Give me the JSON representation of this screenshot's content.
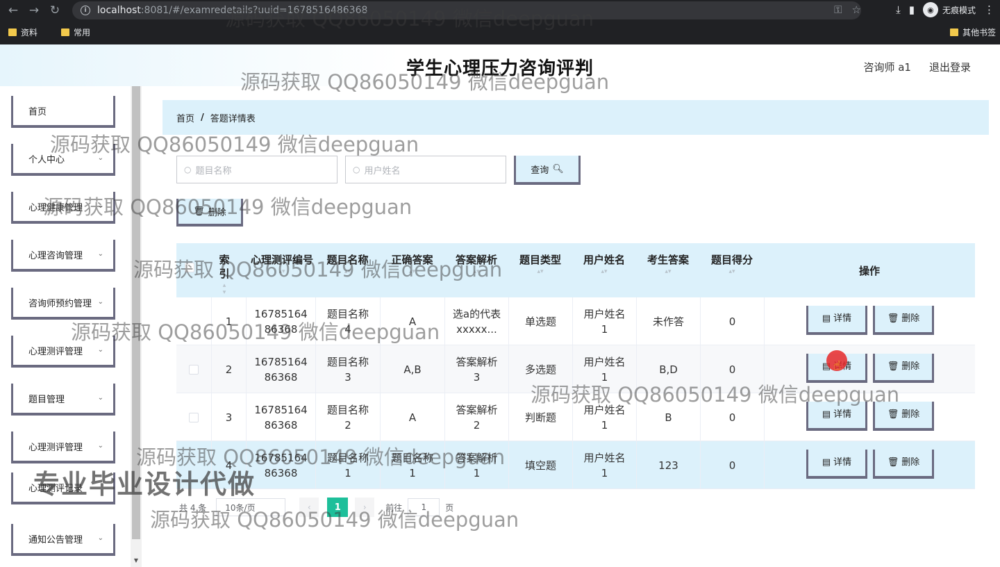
{
  "browser": {
    "url_main": "localhost",
    "url_rest": ":8081/#/examredetails?uuid=1678516486368",
    "incognito_label": "无痕模式",
    "bookmarks": [
      "资料",
      "常用"
    ],
    "bookmarks_right": "其他书签"
  },
  "header": {
    "title": "学生心理压力咨询评判",
    "user": "咨询师 a1",
    "logout": "退出登录"
  },
  "sidebar": {
    "items": [
      {
        "label": "首页",
        "chevron": false
      },
      {
        "label": "个人中心",
        "chevron": true
      },
      {
        "label": "心理健康管理",
        "chevron": true
      },
      {
        "label": "心理咨询管理",
        "chevron": true
      },
      {
        "label": "咨询师预约管理",
        "chevron": true
      },
      {
        "label": "心理测评管理",
        "chevron": true
      },
      {
        "label": "题目管理",
        "chevron": true
      },
      {
        "label": "心理测评管理",
        "chevron": true
      },
      {
        "label": "心理测评记录",
        "chevron": false
      },
      {
        "label": "通知公告管理",
        "chevron": true
      }
    ]
  },
  "breadcrumb": {
    "home": "首页",
    "sep": "/",
    "current": "答题详情表"
  },
  "search": {
    "question_placeholder": "题目名称",
    "user_placeholder": "用户姓名",
    "query_label": "查询",
    "delete_label": "删除"
  },
  "table": {
    "headers": [
      "索引",
      "心理测评编号",
      "题目名称",
      "正确答案",
      "答案解析",
      "题目类型",
      "用户姓名",
      "考生答案",
      "题目得分",
      "操作"
    ],
    "rows": [
      {
        "index": "1",
        "code": "1678516486368",
        "question": "题目名称4",
        "correct": "A",
        "analysis": "选a的代表xxxxx...",
        "type": "单选题",
        "user": "用户姓名1",
        "answer": "未作答",
        "score": "0"
      },
      {
        "index": "2",
        "code": "1678516486368",
        "question": "题目名称3",
        "correct": "A,B",
        "analysis": "答案解析3",
        "type": "多选题",
        "user": "用户姓名1",
        "answer": "B,D",
        "score": "0"
      },
      {
        "index": "3",
        "code": "1678516486368",
        "question": "题目名称2",
        "correct": "A",
        "analysis": "答案解析2",
        "type": "判断题",
        "user": "用户姓名1",
        "answer": "B",
        "score": "0"
      },
      {
        "index": "4",
        "code": "1678516486368",
        "question": "题目名称1",
        "correct": "题目名称1",
        "analysis": "答案解析1",
        "type": "填空题",
        "user": "用户姓名1",
        "answer": "123",
        "score": "0"
      }
    ],
    "detail_label": "详情",
    "delete_label": "删除"
  },
  "pagination": {
    "total": "共 4 条",
    "page_size": "10条/页",
    "current_page": "1",
    "goto_prefix": "前往",
    "goto_value": "1",
    "goto_suffix": "页"
  },
  "watermark": {
    "text": "源码获取 QQ86050149 微信deepguan",
    "big": "专业毕业设计代做"
  }
}
